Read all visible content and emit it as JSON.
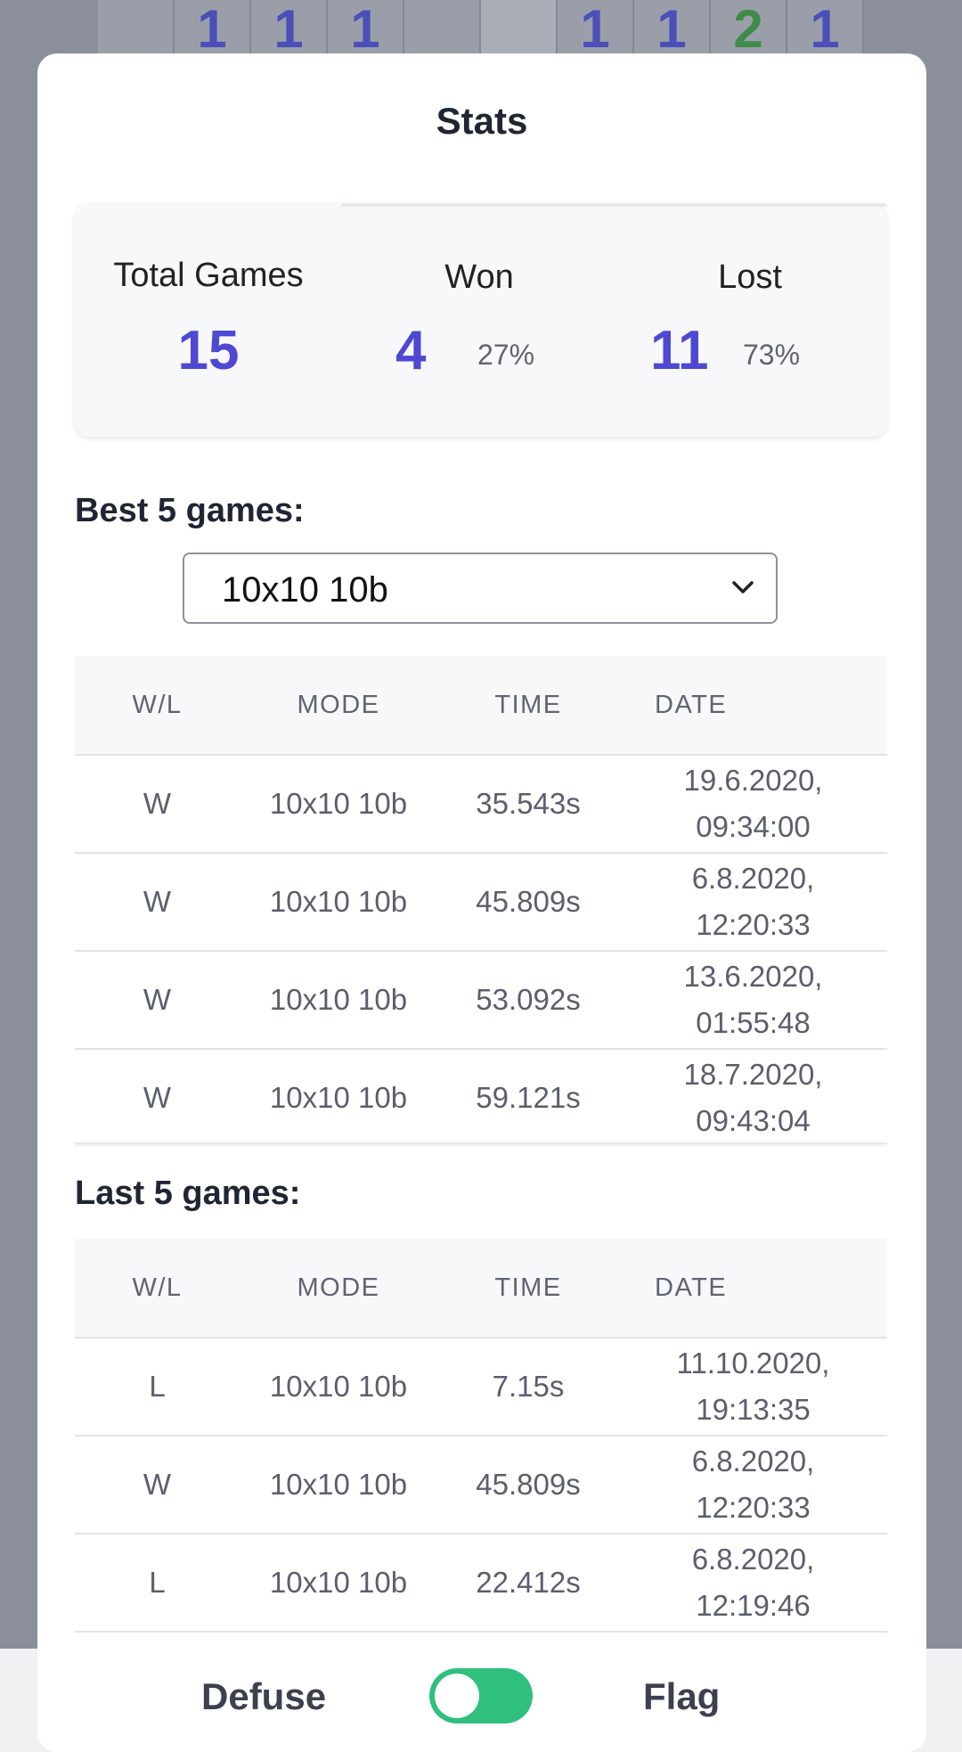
{
  "board": {
    "cells": [
      "",
      "1",
      "1",
      "1",
      "",
      "",
      "1",
      "1",
      "2",
      "1"
    ]
  },
  "modal": {
    "title": "Stats"
  },
  "summary": {
    "total_label": "Total Games",
    "total_value": "15",
    "won_label": "Won",
    "won_value": "4",
    "won_pct": "27%",
    "lost_label": "Lost",
    "lost_value": "11",
    "lost_pct": "73%"
  },
  "best": {
    "label": "Best 5 games:",
    "select_value": "10x10 10b",
    "headers": [
      "W/L",
      "MODE",
      "TIME",
      "DATE"
    ],
    "rows": [
      [
        "W",
        "10x10 10b",
        "35.543s",
        "19.6.2020,\n09:34:00"
      ],
      [
        "W",
        "10x10 10b",
        "45.809s",
        "6.8.2020,\n12:20:33"
      ],
      [
        "W",
        "10x10 10b",
        "53.092s",
        "13.6.2020,\n01:55:48"
      ],
      [
        "W",
        "10x10 10b",
        "59.121s",
        "18.7.2020,\n09:43:04"
      ]
    ]
  },
  "last": {
    "label": "Last 5 games:",
    "headers": [
      "W/L",
      "MODE",
      "TIME",
      "DATE"
    ],
    "rows": [
      [
        "L",
        "10x10 10b",
        "7.15s",
        "11.10.2020,\n19:13:35"
      ],
      [
        "W",
        "10x10 10b",
        "45.809s",
        "6.8.2020,\n12:20:33"
      ],
      [
        "L",
        "10x10 10b",
        "22.412s",
        "6.8.2020,\n12:19:46"
      ]
    ]
  },
  "bottom": {
    "defuse_label": "Defuse",
    "flag_label": "Flag",
    "toggle_on": true
  },
  "colors": {
    "accent": "#4e48d3",
    "toggle": "#2fc07d"
  },
  "icons": {
    "select": "chevron-down-icon"
  }
}
